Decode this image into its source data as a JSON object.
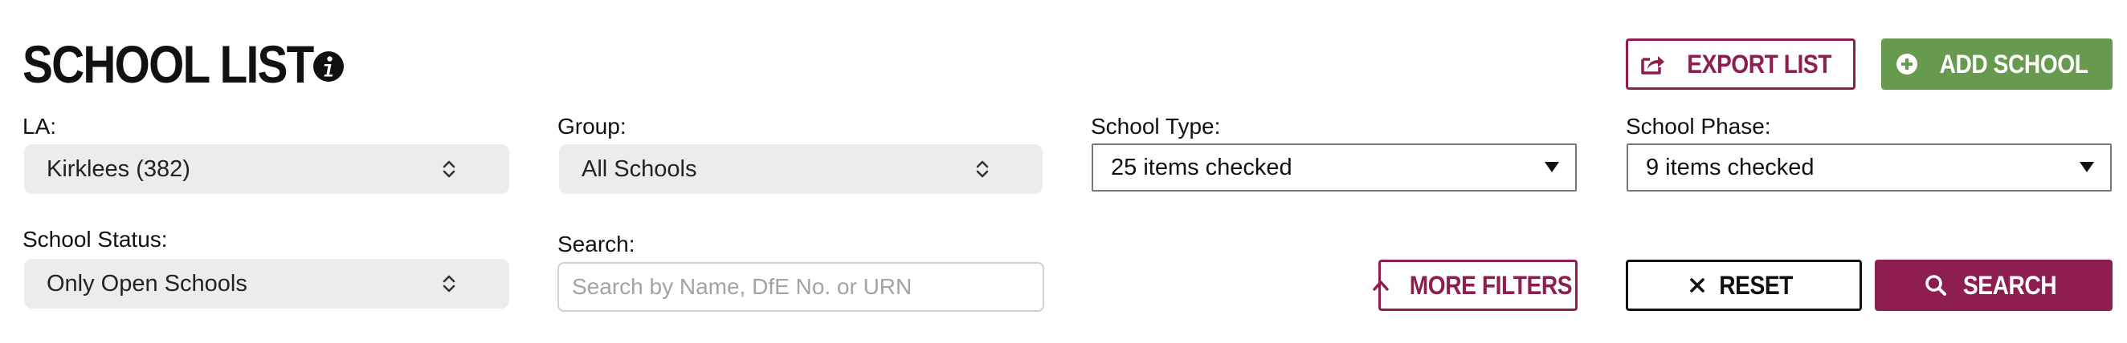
{
  "header": {
    "title": "SCHOOL LIST",
    "export_label": "EXPORT LIST",
    "add_label": "ADD SCHOOL"
  },
  "filters": {
    "la": {
      "label": "LA:",
      "value": "Kirklees (382)"
    },
    "group": {
      "label": "Group:",
      "value": "All Schools"
    },
    "school_type": {
      "label": "School Type:",
      "value": "25 items checked"
    },
    "school_phase": {
      "label": "School Phase:",
      "value": "9 items checked"
    },
    "school_status": {
      "label": "School Status:",
      "value": "Only Open Schools"
    },
    "search": {
      "label": "Search:",
      "placeholder": "Search by Name, DfE No. or URN",
      "value": ""
    }
  },
  "actions": {
    "more_filters_label": "MORE FILTERS",
    "reset_label": "RESET",
    "search_label": "SEARCH"
  },
  "colors": {
    "maroon": "#8e1d50",
    "green": "#67994f",
    "select_grey": "#ececec"
  },
  "icons": {
    "info": "info-icon",
    "export": "export-icon",
    "add": "plus-circle-icon",
    "updown": "up-down-chevron-icon",
    "caret": "caret-down-icon",
    "more_filters": "chevron-up-icon",
    "reset": "close-icon",
    "search": "search-icon"
  }
}
